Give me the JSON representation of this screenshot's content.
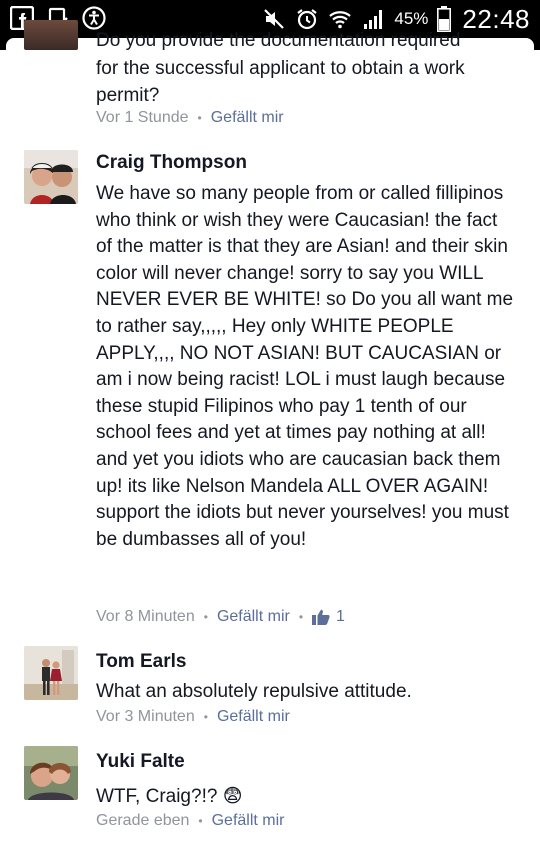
{
  "status": {
    "battery": "45%",
    "time": "22:48"
  },
  "comments": [
    {
      "partial_text": "Do you provide the documentation required",
      "text": "for the successful applicant to obtain a work permit?",
      "time": "Vor 1 Stunde",
      "like_label": "Gefällt mir"
    },
    {
      "author": "Craig Thompson",
      "text": "We have so many people from or called fillipinos who think or wish they were Caucasian! the fact of the matter is that they are Asian! and their skin color will never change! sorry to say you WILL NEVER EVER BE WHITE! so Do you all want me to rather say,,,,, Hey only WHITE PEOPLE APPLY,,,, NO NOT ASIAN! BUT CAUCASIAN or am i now being racist! LOL i must laugh because these stupid Filipinos who pay 1 tenth of our school fees and yet at times pay nothing at all! and yet you idiots who are caucasian back them up! its like Nelson Mandela ALL OVER AGAIN! support the idiots but never yourselves! you must be dumbasses all of you!",
      "time": "Vor 8 Minuten",
      "like_label": "Gefällt mir",
      "like_count": "1"
    },
    {
      "author": "Tom Earls",
      "text": "What an absolutely repulsive attitude.",
      "time": "Vor 3 Minuten",
      "like_label": "Gefällt mir"
    },
    {
      "author": "Yuki Falte",
      "text": "WTF, Craig?!? 😨",
      "time": "Gerade eben",
      "like_label": "Gefällt mir"
    }
  ],
  "colors": {
    "text": "#141823",
    "meta": "#90949c",
    "link": "#5b6f9a"
  },
  "icons": [
    "facebook-icon",
    "clipboard-check-icon",
    "accessibility-icon",
    "mute-icon",
    "alarm-icon",
    "wifi-icon",
    "signal-icon",
    "battery-icon",
    "thumbs-up-icon"
  ]
}
